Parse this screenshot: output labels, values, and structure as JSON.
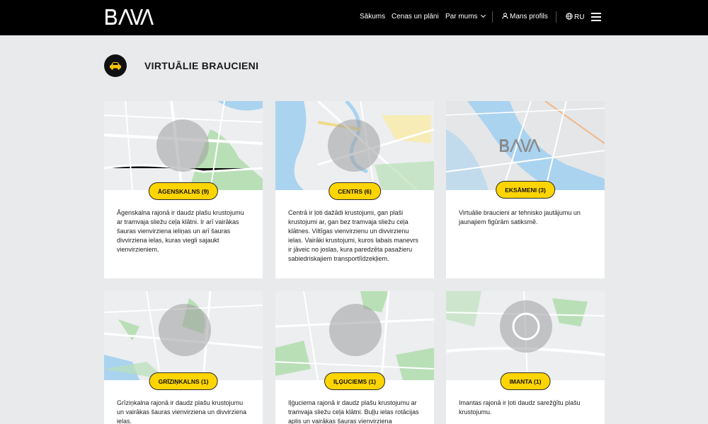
{
  "header": {
    "logo_text": "BAVA",
    "nav": [
      {
        "label": "Sākums"
      },
      {
        "label": "Cenas un plāni"
      },
      {
        "label": "Par mums"
      }
    ],
    "profile_label": "Mans profils",
    "language_label": "RU"
  },
  "page": {
    "title": "VIRTUĀLIE BRAUCIENI",
    "title_icon": "car-icon"
  },
  "cards": [
    {
      "badge": "ĀGENSKALNS (9)",
      "text": "Āgenskalna rajonā ir daudz plašu krustojumu ar tramvaja sliežu ceļa klātni. Ir arī vairākas šauras vienvirziena ieliņas un arī šauras divvirziena ielas, kuras viegli sajaukt vienvirzieniem.",
      "map": "street-map"
    },
    {
      "badge": "CENTRS (6)",
      "text": "Centrā ir ļoti dažādi krustojumi, gan plaši krustojumi ar, gan bez tramvaja sliežu ceļa klātnes. Viltīgas vienvirzienu un divvirzienu ielas. Vairāki krustojumi, kuros labais manevrs ir jāveic no joslas, kura paredzēta pasažieru sabiedriskajiem transportlīdzekļiem.",
      "map": "street-map"
    },
    {
      "badge": "EKSĀMENI (3)",
      "text": "Virtuālie braucieni ar tehnisko jautājumu un jaunajiem figūrām satiksmē.",
      "map": "city-map-with-logo"
    },
    {
      "badge": "GRĪZIŅKALNS (1)",
      "text": "Grīziņkalna rajonā ir daudz plašu krustojumu un vairākas šauras vienvirziena un divvirziena ielas.",
      "map": "street-map"
    },
    {
      "badge": "IĻĢUCIEMS (1)",
      "text": "Iļģuciema rajonā ir daudz plašu krustojumu ar tramvaja sliežu ceļa klātni. Buļļu ielas rotācijas aplis un vairākas šauras vienvirziena",
      "map": "street-map"
    },
    {
      "badge": "IMANTA (1)",
      "text": "Imantas rajonā ir ļoti daudz sarežģītu plašu krustojumu.",
      "map": "street-map"
    }
  ],
  "colors": {
    "header_bg": "#000000",
    "page_bg": "#e9eaec",
    "badge_bg": "#ffd500",
    "accent_yellow": "#f5c400"
  }
}
